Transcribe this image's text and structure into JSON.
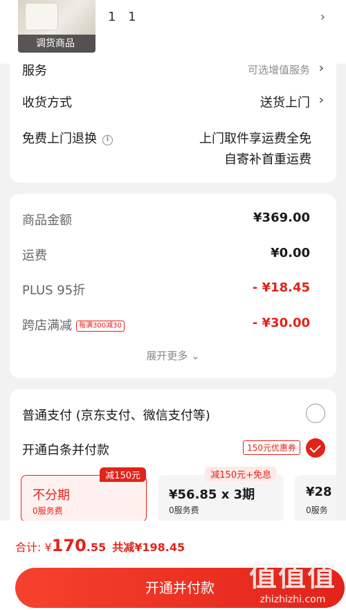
{
  "product": {
    "tag": "调货商品",
    "quantity_text": "1 1",
    "chevron": "›"
  },
  "delivery_card": {
    "service_label": "服务",
    "service_value": "可选增值服务",
    "shipping_label": "收货方式",
    "shipping_value": "送货上门",
    "return_label": "免费上门退换",
    "info_glyph": "i",
    "return_line1": "上门取件享运费全免",
    "return_line2": "自寄补首重运费",
    "chevron": "›"
  },
  "price_card": {
    "rows": [
      {
        "label": "商品金额",
        "value": "¥369.00"
      },
      {
        "label": "运费",
        "value": "¥0.00"
      },
      {
        "label": "PLUS 95折",
        "value": "- ¥18.45"
      },
      {
        "label": "跨店满减",
        "badge": "每满300减30",
        "value": "- ¥30.00"
      }
    ],
    "expand_label": "展开更多 ⌄"
  },
  "payment_card": {
    "normal_label": "普通支付 (京东支付、微信支付等)",
    "baitiao_label": "开通白条并付款",
    "coupon": "150元优惠券",
    "plans": [
      {
        "main": "不分期",
        "sub": "0服务费",
        "tag": "减150元",
        "selected": true
      },
      {
        "main": "¥56.85 x 3期",
        "sub": "0服务费",
        "tag": "减150元+免息",
        "selected": false
      },
      {
        "main": "¥28",
        "sub": "0服务",
        "tag": "",
        "selected": false
      }
    ]
  },
  "bottom_bar": {
    "total_prefix": "合计: ¥",
    "total_int": "170",
    "total_cents": ".55",
    "saving": "共减¥198.45",
    "pay_button": "开通并付款"
  },
  "watermark": {
    "logo": "值值值",
    "site": "zhizhizhi.com"
  },
  "colors": {
    "accent": "#e2231a",
    "background": "#f2f2f2"
  }
}
